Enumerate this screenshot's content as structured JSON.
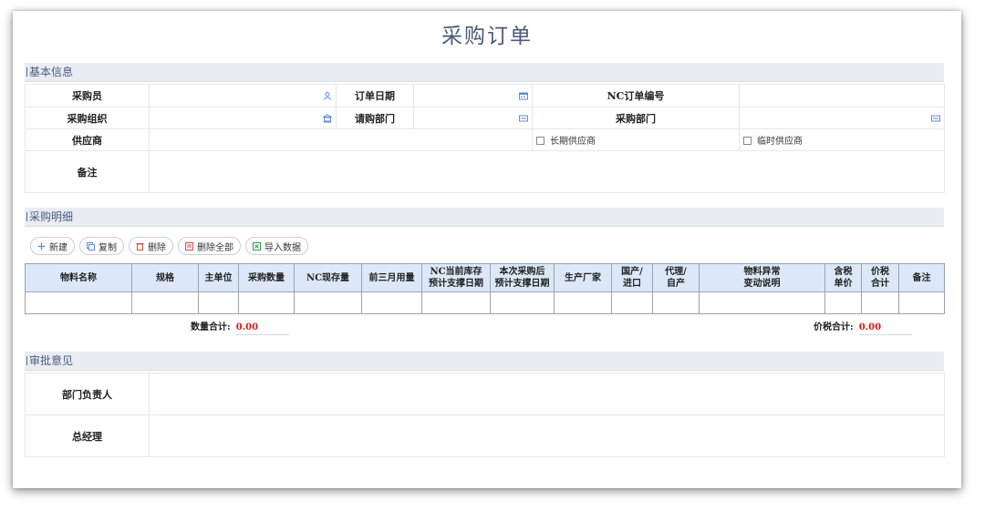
{
  "page_title": "采购订单",
  "basic": {
    "section_title": "基本信息",
    "purchaser_label": "采购员",
    "order_date_label": "订单日期",
    "nc_order_no_label": "NC订单编号",
    "purchase_org_label": "采购组织",
    "request_dept_label": "请购部门",
    "purchase_dept_label": "采购部门",
    "supplier_label": "供应商",
    "long_term_supplier_label": "长期供应商",
    "temp_supplier_label": "临时供应商",
    "remarks_label": "备注"
  },
  "detail": {
    "section_title": "采购明细",
    "toolbar": {
      "new": "新建",
      "copy": "复制",
      "delete": "删除",
      "delete_all": "删除全部",
      "import": "导入数据"
    },
    "columns": [
      "物料名称",
      "规格",
      "主单位",
      "采购数量",
      "NC现存量",
      "前三月用量",
      "NC当前库存\n预计支撑日期",
      "本次采购后\n预计支撑日期",
      "生产厂家",
      "国产/\n进口",
      "代理/\n自产",
      "物料异常\n变动说明",
      "含税\n单价",
      "价税\n合计",
      "备注"
    ],
    "qty_total_label": "数量合计:",
    "qty_total_value": "0.00",
    "tax_total_label": "价税合计:",
    "tax_total_value": "0.00"
  },
  "approval": {
    "section_title": "审批意见",
    "dept_head_label": "部门负责人",
    "gm_label": "总经理"
  },
  "colors": {
    "accent": "#4a5a7a",
    "header_bg": "#dce8f7",
    "total_red": "#d51a1a",
    "icon_blue": "#5a8fd6"
  }
}
